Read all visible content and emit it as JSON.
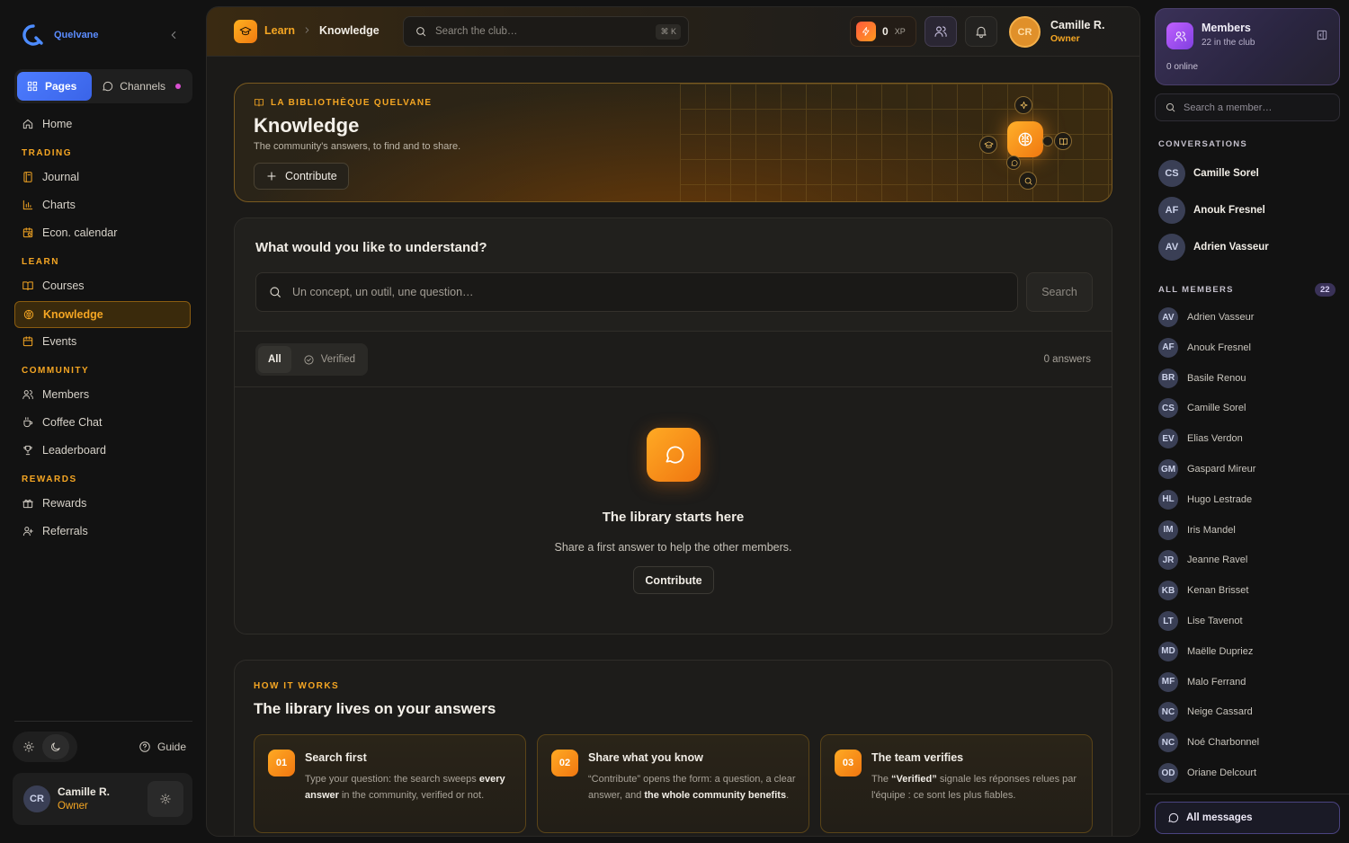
{
  "brand": {
    "name": "Quelvane"
  },
  "sidebar": {
    "tabs": {
      "pages": "Pages",
      "channels": "Channels"
    },
    "home": "Home",
    "sections": {
      "trading": "TRADING",
      "learn": "LEARN",
      "community": "COMMUNITY",
      "rewards": "REWARDS"
    },
    "items": {
      "journal": "Journal",
      "charts": "Charts",
      "econ": "Econ. calendar",
      "courses": "Courses",
      "knowledge": "Knowledge",
      "events": "Events",
      "members": "Members",
      "coffee": "Coffee Chat",
      "leaderboard": "Leaderboard",
      "rewards": "Rewards",
      "referrals": "Referrals"
    },
    "guide": "Guide",
    "user": {
      "initials": "CR",
      "name": "Camille R.",
      "role": "Owner"
    }
  },
  "topbar": {
    "crumb_parent": "Learn",
    "crumb_current": "Knowledge",
    "search_placeholder": "Search the club…",
    "shortcut": "⌘ K",
    "xp_value": "0",
    "xp_unit": "XP",
    "user": {
      "initials": "CR",
      "name": "Camille R.",
      "role": "Owner"
    }
  },
  "hero": {
    "eyebrow": "LA BIBLIOTHÈQUE QUELVANE",
    "title": "Knowledge",
    "subtitle": "The community's answers, to find and to share.",
    "button": "Contribute"
  },
  "ask": {
    "question": "What would you like to understand?",
    "placeholder": "Un concept, un outil, une question…",
    "search_button": "Search",
    "filters": {
      "all": "All",
      "verified": "Verified"
    },
    "count": "0 answers",
    "empty_title": "The library starts here",
    "empty_sub": "Share a first answer to help the other members.",
    "empty_button": "Contribute"
  },
  "how": {
    "eyebrow": "HOW IT WORKS",
    "title": "The library lives on your answers",
    "steps": [
      {
        "num": "01",
        "title": "Search first",
        "b1": "Type your question: the search sweeps ",
        "bold": "every answer",
        "b2": " in the community, verified or not."
      },
      {
        "num": "02",
        "title": "Share what you know",
        "b1": "“Contribute” opens the form: a question, a clear answer, and ",
        "bold": "the whole community benefits",
        "b2": "."
      },
      {
        "num": "03",
        "title": "The team verifies",
        "b1": "The ",
        "bold": "“Verified”",
        "b2": " signale les réponses relues par l'équipe : ce sont les plus fiables."
      }
    ]
  },
  "rpanel": {
    "title": "Members",
    "subtitle": "22 in the club",
    "online": "0 online",
    "search_placeholder": "Search a member…",
    "conv_label": "CONVERSATIONS",
    "conversations": [
      {
        "initials": "CS",
        "name": "Camille Sorel"
      },
      {
        "initials": "AF",
        "name": "Anouk Fresnel"
      },
      {
        "initials": "AV",
        "name": "Adrien Vasseur"
      }
    ],
    "all_label": "ALL MEMBERS",
    "all_count": "22",
    "members": [
      {
        "initials": "AV",
        "name": "Adrien Vasseur"
      },
      {
        "initials": "AF",
        "name": "Anouk Fresnel"
      },
      {
        "initials": "BR",
        "name": "Basile Renou"
      },
      {
        "initials": "CS",
        "name": "Camille Sorel"
      },
      {
        "initials": "EV",
        "name": "Elias Verdon"
      },
      {
        "initials": "GM",
        "name": "Gaspard Mireur"
      },
      {
        "initials": "HL",
        "name": "Hugo Lestrade"
      },
      {
        "initials": "IM",
        "name": "Iris Mandel"
      },
      {
        "initials": "JR",
        "name": "Jeanne Ravel"
      },
      {
        "initials": "KB",
        "name": "Kenan Brisset"
      },
      {
        "initials": "LT",
        "name": "Lise Tavenot"
      },
      {
        "initials": "MD",
        "name": "Maëlle Dupriez"
      },
      {
        "initials": "MF",
        "name": "Malo Ferrand"
      },
      {
        "initials": "NC",
        "name": "Neige Cassard"
      },
      {
        "initials": "NC",
        "name": "Noé Charbonnel"
      },
      {
        "initials": "OD",
        "name": "Oriane Delcourt"
      }
    ],
    "all_messages": "All messages"
  },
  "colors": {
    "accent": "#f5a623",
    "brand_blue": "#5b8cff",
    "members_purple": "#8040e0"
  }
}
